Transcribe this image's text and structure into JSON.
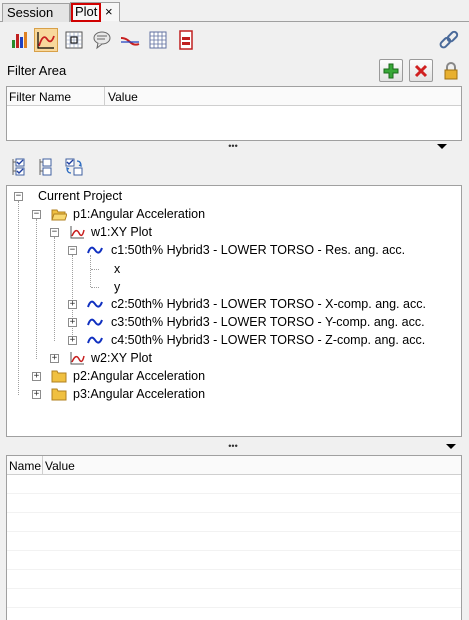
{
  "tabs": [
    {
      "label": "Session"
    },
    {
      "label": "Plot",
      "close": "×"
    }
  ],
  "toolbar": {
    "icons": [
      "bar-chart-icon",
      "curve-plot-icon",
      "grid-dots-icon",
      "note-icon",
      "low-pass-icon",
      "grid-icon",
      "page-icon",
      "link-icon"
    ]
  },
  "filter": {
    "title": "Filter Area",
    "columns": [
      "Filter Name",
      "Value"
    ],
    "splitter": "•••"
  },
  "tree": {
    "root": "Current Project",
    "p1": "p1:Angular Acceleration",
    "w1": "w1:XY Plot",
    "c1": "c1:50th% Hybrid3   - LOWER TORSO - Res. ang. acc.",
    "x": "x",
    "y": "y",
    "c2": "c2:50th% Hybrid3   - LOWER TORSO - X-comp. ang. acc.",
    "c3": "c3:50th% Hybrid3   - LOWER TORSO - Y-comp. ang. acc.",
    "c4": "c4:50th% Hybrid3   - LOWER TORSO - Z-comp. ang. acc.",
    "w2": "w2:XY Plot",
    "p2": "p2:Angular Acceleration",
    "p3": "p3:Angular Acceleration"
  },
  "props": {
    "columns": [
      "Name",
      "Value"
    ],
    "splitter": "•••"
  },
  "colors": {
    "highlight": "#d00000",
    "curve": "#1030c0",
    "plot_icon": "#c82020",
    "folder": "#f0c040"
  }
}
